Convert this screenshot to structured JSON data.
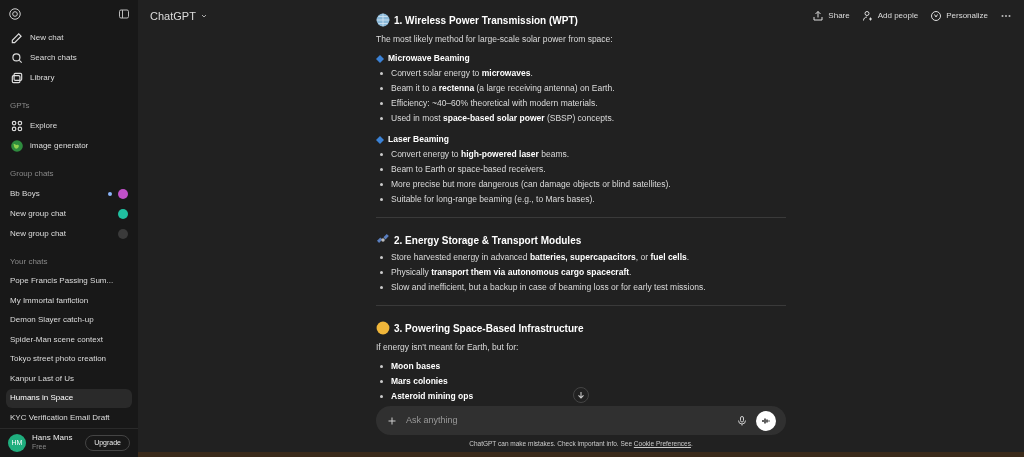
{
  "sidebar": {
    "nav": [
      {
        "kind": "new",
        "label": "New chat"
      },
      {
        "kind": "search",
        "label": "Search chats"
      },
      {
        "kind": "library",
        "label": "Library"
      }
    ],
    "gpts_heading": "GPTs",
    "gpts": [
      {
        "kind": "explore",
        "label": "Explore"
      },
      {
        "kind": "globe",
        "label": "image generator"
      }
    ],
    "group_heading": "Group chats",
    "groups": [
      {
        "label": "Bb Boys",
        "unread": true,
        "color": "#c050c8"
      },
      {
        "label": "New group chat",
        "unread": false,
        "color": "#20c0a0"
      },
      {
        "label": "New group chat",
        "unread": false,
        "color": "#3a3a3a"
      }
    ],
    "chats_heading": "Your chats",
    "chats": [
      {
        "label": "Pope Francis Passing Sum...",
        "selected": false
      },
      {
        "label": "My Immortal fanfiction",
        "selected": false
      },
      {
        "label": "Demon Slayer catch-up",
        "selected": false
      },
      {
        "label": "Spider-Man scene context",
        "selected": false
      },
      {
        "label": "Tokyo street photo creation",
        "selected": false
      },
      {
        "label": "Kanpur Last of Us",
        "selected": false
      },
      {
        "label": "Humans in Space",
        "selected": true
      },
      {
        "label": "KYC Verification Email Draft",
        "selected": false
      }
    ],
    "user": {
      "initials": "HM",
      "name": "Hans Mans",
      "plan": "Free",
      "upgrade": "Upgrade"
    }
  },
  "header": {
    "model": "ChatGPT",
    "actions": [
      {
        "kind": "share",
        "label": "Share"
      },
      {
        "kind": "people",
        "label": "Add people"
      },
      {
        "kind": "personalize",
        "label": "Personalize"
      }
    ]
  },
  "sections": [
    {
      "kind": "globe",
      "heading": "1. Wireless Power Transmission (WPT)",
      "intro": "The most likely method for large-scale solar power from space:",
      "groups": [
        {
          "title": "Microwave Beaming",
          "bullets": [
            "Convert solar energy to **microwaves**.",
            "Beam it to a **rectenna** (a large receiving antenna) on Earth.",
            "Efficiency: ~40–60% theoretical with modern materials.",
            "Used in most **space-based solar power** (SBSP) concepts."
          ]
        },
        {
          "title": "Laser Beaming",
          "bullets": [
            "Convert energy to **high-powered laser** beams.",
            "Beam to Earth or space-based receivers.",
            "More precise but more dangerous (can damage objects or blind satellites).",
            "Suitable for long-range beaming (e.g., to Mars bases)."
          ]
        }
      ]
    },
    {
      "kind": "satellite",
      "heading": "2. Energy Storage & Transport Modules",
      "groups": [
        {
          "bullets": [
            "Store harvested energy in advanced **batteries, supercapacitors**, or **fuel cells**.",
            "Physically **transport them via autonomous cargo spacecraft**.",
            "Slow and inefficient, but a backup in case of beaming loss or for early test missions."
          ]
        }
      ]
    },
    {
      "kind": "sun",
      "heading": "3. Powering Space-Based Infrastructure",
      "intro": "If energy isn't meant for Earth, but for:",
      "groups": [
        {
          "bullets": [
            "**Moon bases**",
            "**Mars colonies**",
            "**Asteroid mining ops**"
          ]
        }
      ]
    }
  ],
  "composer": {
    "placeholder": "Ask anything"
  },
  "footer": {
    "text": "ChatGPT can make mistakes. Check important info. See ",
    "link": "Cookie Preferences",
    "end": "."
  }
}
